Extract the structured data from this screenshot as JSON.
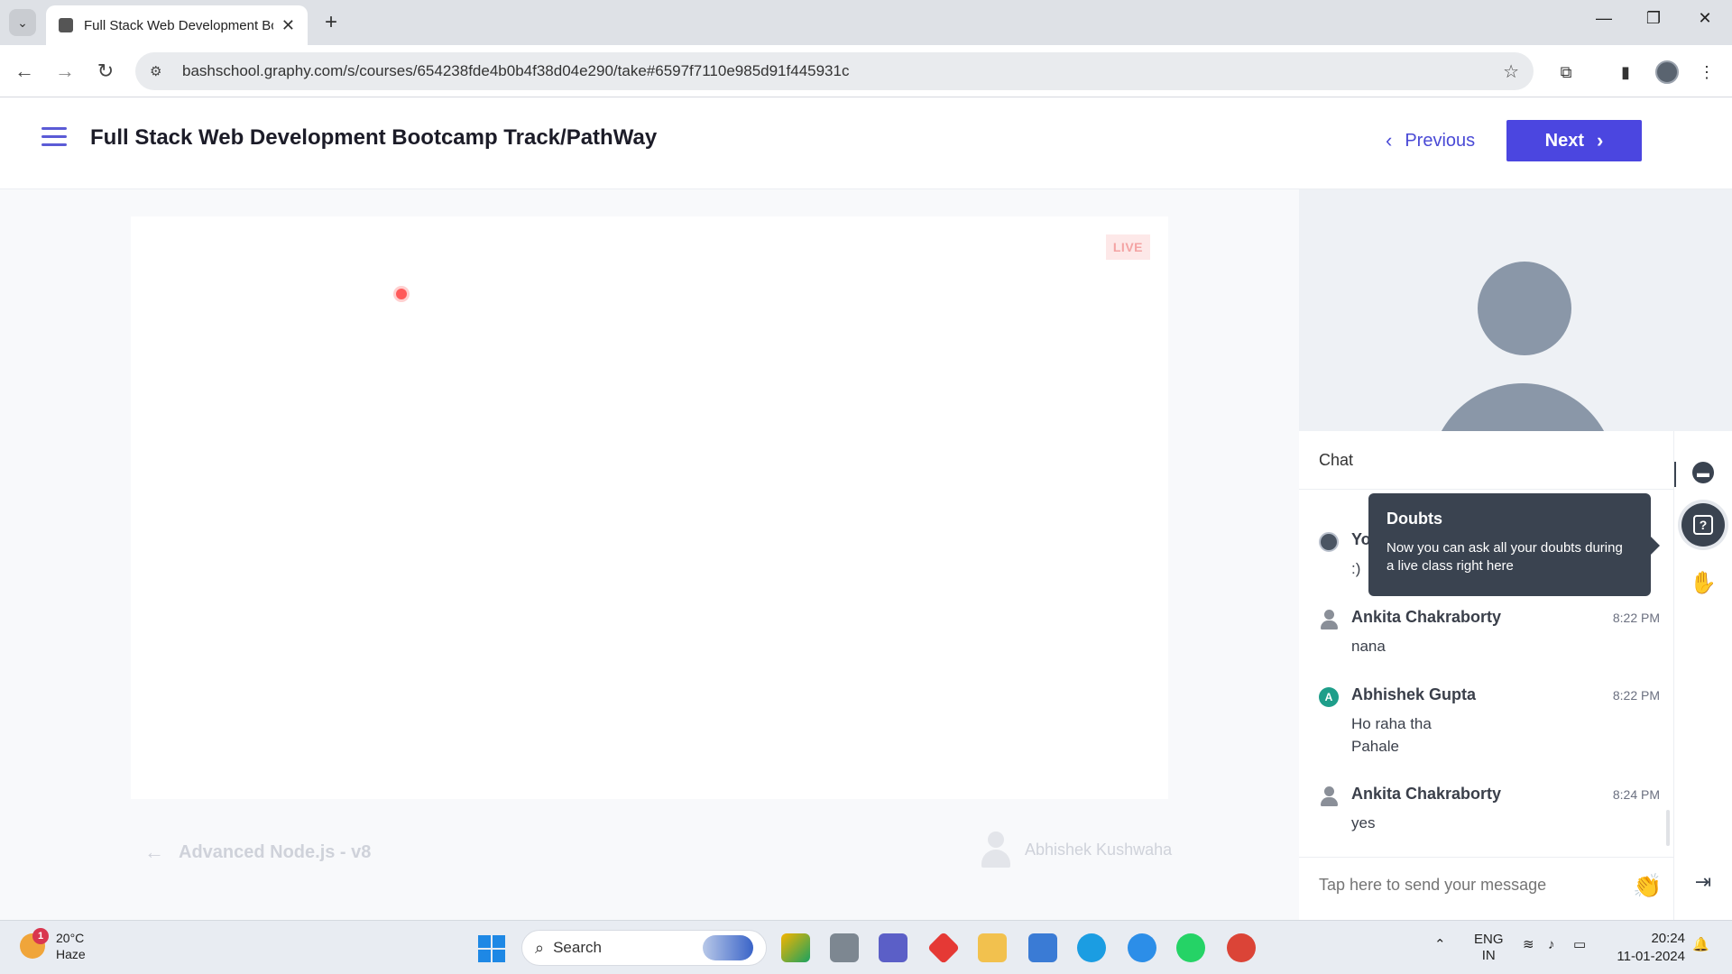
{
  "browser": {
    "tab_title": "Full Stack Web Development Bc",
    "url": "bashschool.graphy.com/s/courses/654238fde4b0b4f38d04e290/take#6597f7110e985d91f445931c"
  },
  "header": {
    "course_title": "Full Stack Web Development Bootcamp Track/PathWay",
    "previous_label": "Previous",
    "next_label": "Next"
  },
  "player": {
    "live_badge": "LIVE",
    "previous_lesson": "Advanced Node.js - v8",
    "instructor": "Abhishek Kushwaha"
  },
  "chat": {
    "title": "Chat",
    "messages": [
      {
        "name": "You",
        "time": "",
        "text": ":)",
        "avatar": "photo"
      },
      {
        "name": "Ankita Chakraborty",
        "time": "8:22 PM",
        "text": "nana",
        "avatar": "person"
      },
      {
        "name": "Abhishek Gupta",
        "time": "8:22 PM",
        "text_lines": [
          "Ho raha tha",
          "Pahale"
        ],
        "avatar": "A"
      },
      {
        "name": "Ankita Chakraborty",
        "time": "8:24 PM",
        "text": "yes",
        "avatar": "person"
      }
    ],
    "input_placeholder": "Tap here to send your message"
  },
  "tooltip": {
    "title": "Doubts",
    "text": "Now you can ask all your doubts during a live class right here"
  },
  "side_icons": [
    "chat-icon",
    "doubts-icon",
    "raise-hand-icon",
    "exit-icon"
  ],
  "taskbar": {
    "weather_temp": "20°C",
    "weather_desc": "Haze",
    "weather_badge": "1",
    "search_label": "Search",
    "lang_top": "ENG",
    "lang_bottom": "IN",
    "time": "20:24",
    "date": "11-01-2024"
  },
  "colors": {
    "accent": "#4b46e0",
    "chat_dark": "#3a4350",
    "live_red": "#ff5a5a"
  }
}
